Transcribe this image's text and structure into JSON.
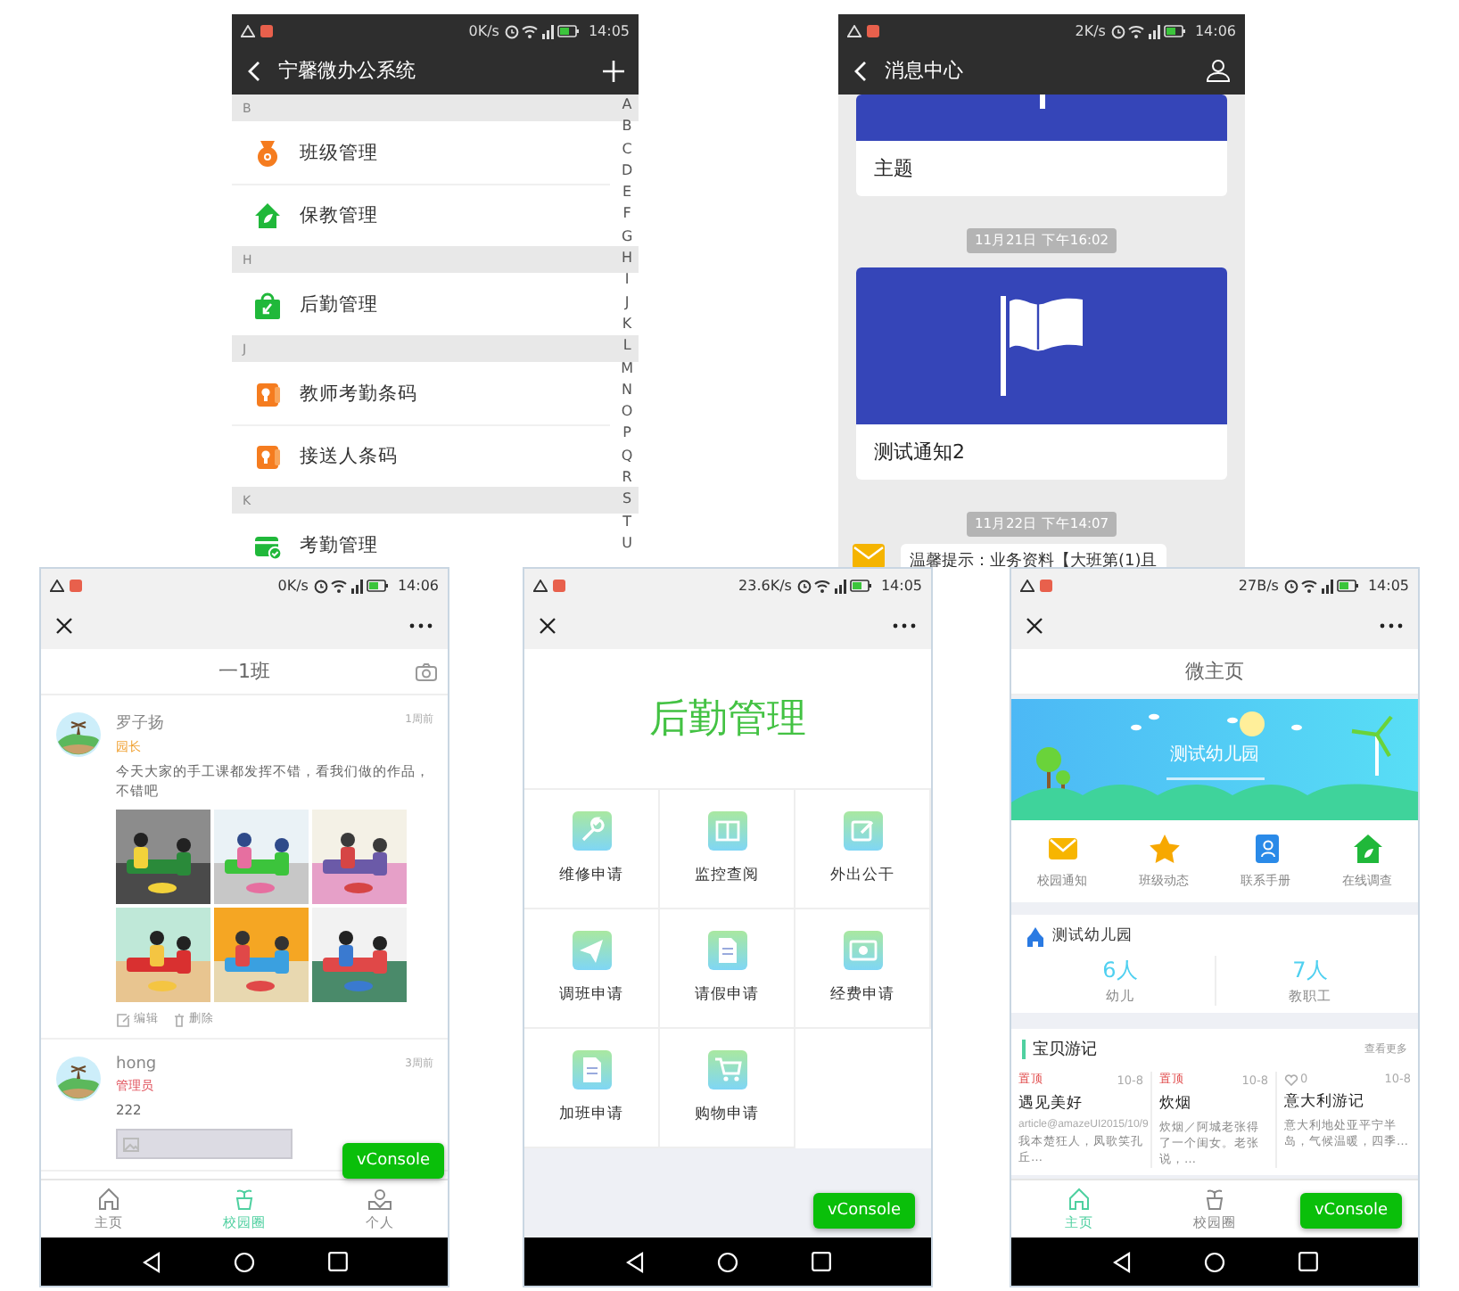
{
  "screens": [
    {
      "kind": "contacts",
      "status": {
        "speed": "0K/s",
        "time": "14:05"
      },
      "header": {
        "title": "宁馨微办公系统"
      },
      "groups": [
        {
          "letter": "B",
          "items": [
            {
              "label": "班级管理",
              "kind": "medal"
            },
            {
              "label": "保教管理",
              "kind": "house"
            }
          ]
        },
        {
          "letter": "H",
          "items": [
            {
              "label": "后勤管理",
              "kind": "bag"
            }
          ]
        },
        {
          "letter": "J",
          "items": [
            {
              "label": "教师考勤条码",
              "kind": "card"
            },
            {
              "label": "接送人条码",
              "kind": "card"
            }
          ]
        },
        {
          "letter": "K",
          "items": [
            {
              "label": "考勤管理",
              "kind": "calendar"
            }
          ]
        }
      ],
      "index": [
        "A",
        "B",
        "C",
        "D",
        "E",
        "F",
        "G",
        "H",
        "I",
        "J",
        "K",
        "L",
        "M",
        "N",
        "O",
        "P",
        "Q",
        "R",
        "S",
        "T",
        "U"
      ]
    },
    {
      "kind": "messages",
      "status": {
        "speed": "2K/s",
        "time": "14:06"
      },
      "header": {
        "title": "消息中心"
      },
      "feed": [
        {
          "kind": "card",
          "title": "主题"
        },
        {
          "kind": "time",
          "text": "11月21日 下午16:02"
        },
        {
          "kind": "card",
          "title": "测试通知2"
        },
        {
          "kind": "time",
          "text": "11月22日 下午14:07"
        },
        {
          "kind": "message",
          "text": "温馨提示：业务资料【大班第(1)且"
        }
      ]
    },
    {
      "kind": "moments",
      "status": {
        "speed": "0K/s",
        "time": "14:06"
      },
      "title": "一1班",
      "posts": [
        {
          "name": "罗子扬",
          "time": "1周前",
          "role": "园长",
          "color": "#f0a030",
          "text": "今天大家的手工课都发挥不错，看我们做的作品，不错吧",
          "photos": [
            {
              "kind": "picture"
            },
            {
              "kind": "picture"
            },
            {
              "kind": "picture"
            },
            {
              "kind": "picture"
            },
            {
              "kind": "picture"
            },
            {
              "kind": "picture"
            }
          ],
          "actions": [
            {
              "label": "编辑"
            },
            {
              "label": "删除"
            }
          ]
        },
        {
          "name": "hong",
          "time": "3周前",
          "role": "管理员",
          "color": "#e0505a",
          "text": "222",
          "photos": [
            {
              "kind": "placeholder"
            }
          ]
        }
      ],
      "overlay_button": "vConsole",
      "tabs": [
        {
          "label": "主页",
          "selected": false
        },
        {
          "label": "校园圈",
          "selected": true
        },
        {
          "label": "个人",
          "selected": false
        }
      ]
    },
    {
      "kind": "menu",
      "status": {
        "speed": "23.6K/s",
        "time": "14:05"
      },
      "heading": "后勤管理",
      "tiles": [
        {
          "label": "维修申请"
        },
        {
          "label": "监控查阅"
        },
        {
          "label": "外出公干"
        },
        {
          "label": "调班申请"
        },
        {
          "label": "请假申请"
        },
        {
          "label": "经费申请"
        },
        {
          "label": "加班申请"
        },
        {
          "label": "购物申请"
        }
      ],
      "overlay_button": "vConsole"
    },
    {
      "kind": "home",
      "status": {
        "speed": "27B/s",
        "time": "14:05"
      },
      "title": "微主页",
      "banner": {
        "title": "测试幼儿园"
      },
      "shortcuts": [
        {
          "label": "校园通知"
        },
        {
          "label": "班级动态"
        },
        {
          "label": "联系手册"
        },
        {
          "label": "在线调查"
        }
      ],
      "school": {
        "name": "测试幼儿园",
        "stats": [
          {
            "value": "6人",
            "label": "幼儿"
          },
          {
            "value": "7人",
            "label": "教职工"
          }
        ]
      },
      "section": {
        "title": "宝贝游记",
        "more": "查看更多",
        "articles": [
          {
            "tag": "置顶",
            "date": "10-8",
            "title": "遇见美好",
            "meta": "article@amazeUI2015/10/9",
            "summary": "我本楚狂人，凤歌笑孔丘…"
          },
          {
            "tag": "置顶",
            "date": "10-8",
            "title": "炊烟",
            "summary": "炊烟／阿城老张得了一个闺女。老张说，…"
          },
          {
            "likes": "0",
            "date": "10-8",
            "title": "意大利游记",
            "summary": "意大利地处亚平宁半岛，气候温暖，四季…"
          }
        ]
      },
      "overlay_button": "vConsole",
      "tabs": [
        {
          "label": "主页",
          "selected": true
        },
        {
          "label": "校园圈",
          "selected": false
        }
      ]
    }
  ]
}
